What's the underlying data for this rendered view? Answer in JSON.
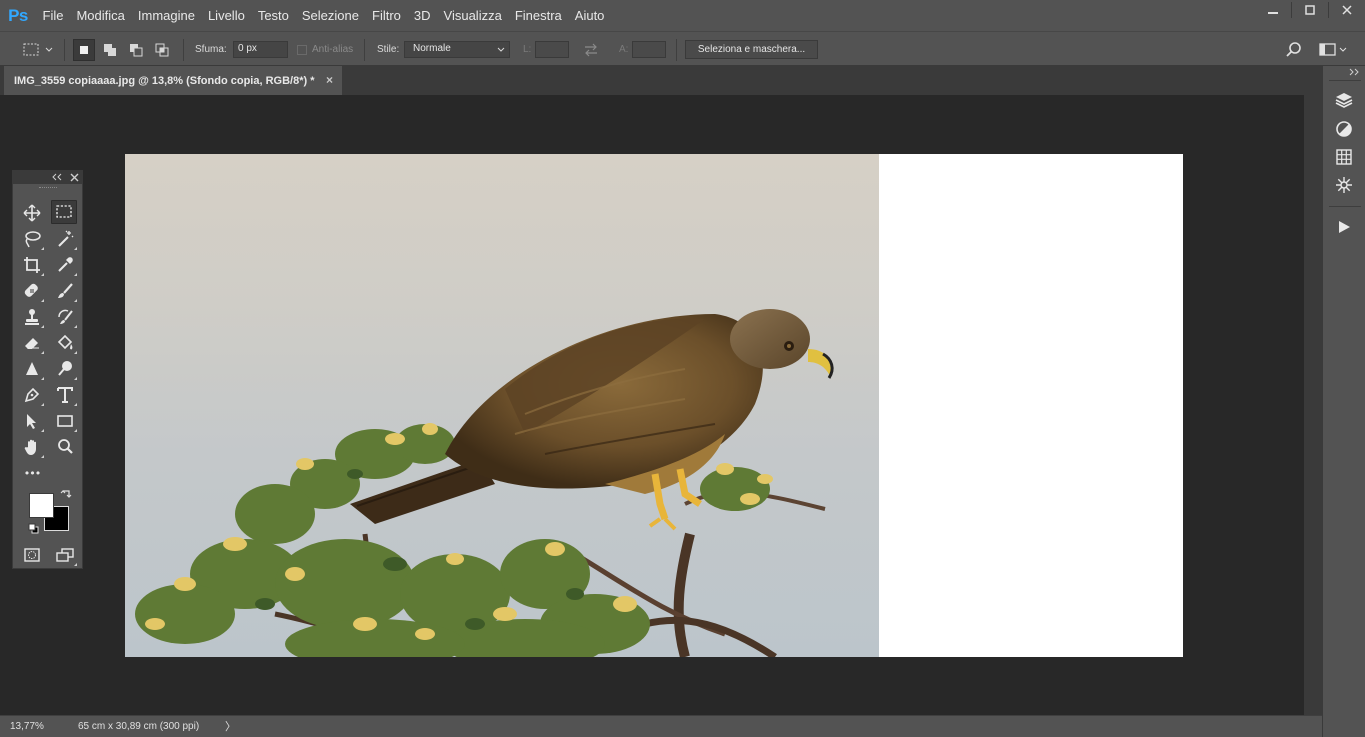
{
  "app": {
    "logo": "Ps"
  },
  "menu": [
    "File",
    "Modifica",
    "Immagine",
    "Livello",
    "Testo",
    "Selezione",
    "Filtro",
    "3D",
    "Visualizza",
    "Finestra",
    "Aiuto"
  ],
  "window_controls": {
    "minimize": "—",
    "maximize": "☐",
    "close": "✕"
  },
  "options": {
    "feather_label": "Sfuma:",
    "feather_value": "0 px",
    "antialias_label": "Anti-alias",
    "style_label": "Stile:",
    "style_value": "Normale",
    "width_label": "L:",
    "height_label": "A:",
    "select_mask_button": "Seleziona e maschera..."
  },
  "document": {
    "tab_title": "IMG_3559 copiaaaa.jpg @ 13,8% (Sfondo copia, RGB/8*) *",
    "tab_close": "×"
  },
  "status": {
    "zoom": "13,77%",
    "doc_info": "65 cm x 30,89 cm (300 ppi)",
    "arrow": "〉"
  },
  "colors": {
    "accent_logo": "#31a8ff",
    "foreground_color": "#ffffff",
    "background_color": "#000000",
    "ui_panel": "#535353",
    "ui_dark": "#282828"
  },
  "tools": [
    "move-tool",
    "rectangular-marquee-tool",
    "lasso-tool",
    "magic-wand-tool",
    "crop-tool",
    "eyedropper-tool",
    "healing-brush-tool",
    "brush-tool",
    "clone-stamp-tool",
    "history-brush-tool",
    "eraser-tool",
    "paint-bucket-tool",
    "sharpen-tool",
    "dodge-tool",
    "pen-tool",
    "type-tool",
    "path-selection-tool",
    "rectangle-tool",
    "hand-tool",
    "zoom-tool"
  ],
  "tools_more": "•••",
  "right_panels": [
    "layers-icon",
    "adjustments-icon",
    "grid-icon",
    "snowflake-icon",
    "play-icon"
  ]
}
